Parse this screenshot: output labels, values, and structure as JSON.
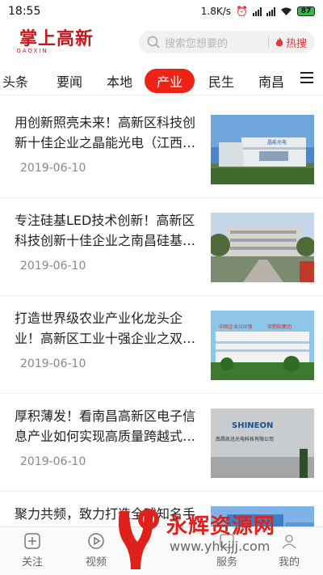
{
  "status_bar": {
    "time": "18:55",
    "network_speed": "1.8K/s",
    "battery": "87"
  },
  "header": {
    "logo_text": "掌上高新",
    "logo_sub": "GAOXIN",
    "search_placeholder": "搜索您想要的",
    "hot_search_label": "热搜"
  },
  "tabs": [
    {
      "label": "头条",
      "active": false
    },
    {
      "label": "要闻",
      "active": false
    },
    {
      "label": "本地",
      "active": false
    },
    {
      "label": "产业",
      "active": true
    },
    {
      "label": "民生",
      "active": false
    },
    {
      "label": "南昌",
      "active": false
    }
  ],
  "articles": [
    {
      "title": "用创新照亮未来！高新区科技创新十佳企业之晶能光电（江西…",
      "date": "2019-06-10",
      "image": "晶能光电 building"
    },
    {
      "title": "专注硅基LED技术创新！高新区科技创新十佳企业之南昌硅基…",
      "date": "2019-06-10",
      "image": "南昌硅基 building"
    },
    {
      "title": "打造世界级农业产业化龙头企业！高新区工业十强企业之双…",
      "date": "2019-06-10",
      "image": "双胞胎集团 building"
    },
    {
      "title": "厚积薄发！看南昌高新区电子信息产业如何实现高质量跨越式…",
      "date": "2019-06-10",
      "image": "SHINEON lobby"
    },
    {
      "title": "聚力共频，致力打造全球知名手",
      "date": "",
      "image": "campus"
    }
  ],
  "thumb_text": {
    "sign1": "晶能光电",
    "sign3a": "中国企业500强",
    "sign3b": "双胞胎集团",
    "logo4": "SHINEON",
    "sign4": "南昌凯迅光电科技有限公司"
  },
  "bottom_nav": [
    {
      "label": "关注",
      "icon": "plus-square-icon"
    },
    {
      "label": "视频",
      "icon": "play-circle-icon"
    },
    {
      "label": "服务",
      "icon": "service-icon"
    },
    {
      "label": "我的",
      "icon": "user-icon"
    }
  ],
  "watermark": {
    "text": "永辉资源网",
    "url": "www.yhkjjj.com"
  },
  "colors": {
    "brand_red": "#c8161d",
    "tab_active_bg": "#ef2217",
    "hot_red": "#e4393c"
  }
}
